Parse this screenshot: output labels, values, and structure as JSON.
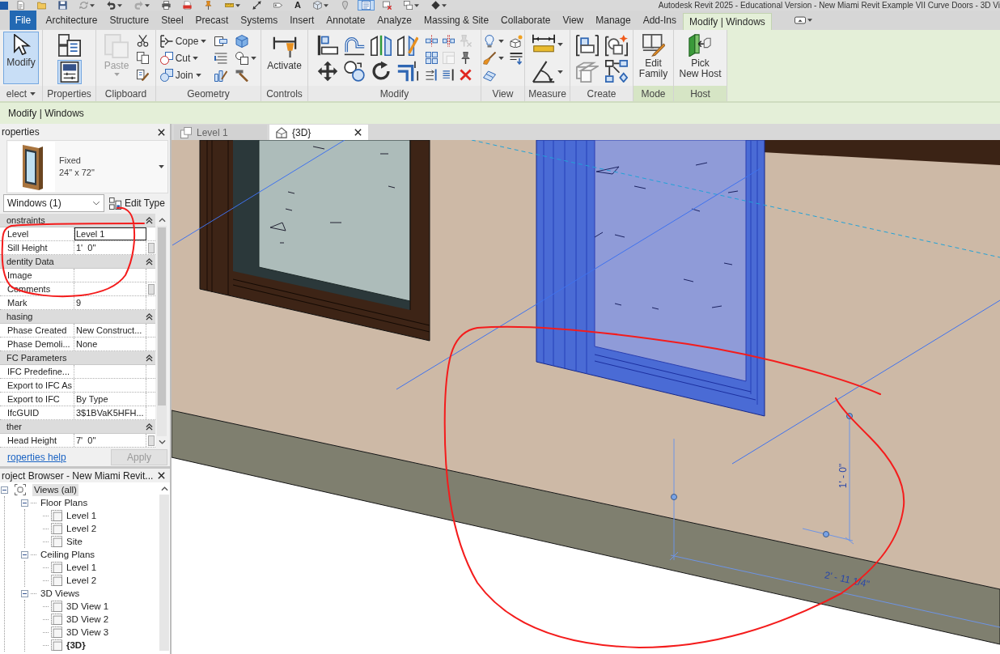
{
  "title_bar": {
    "title": "Autodesk Revit 2025 - Educational Version - New Miami Revit Example VII Curve Doors - 3D Vi"
  },
  "quick_access": [
    {
      "dropdown": false,
      "selected": false
    },
    {
      "dropdown": false,
      "selected": false
    },
    {
      "dropdown": false,
      "selected": false
    },
    {
      "dropdown": true,
      "selected": false
    },
    {
      "dropdown": true,
      "selected": false
    },
    {
      "dropdown": true,
      "selected": false
    },
    {
      "dropdown": false,
      "selected": false
    },
    {
      "dropdown": false,
      "selected": false
    },
    {
      "dropdown": false,
      "selected": false
    },
    {
      "dropdown": true,
      "selected": false
    },
    {
      "dropdown": false,
      "selected": false
    },
    {
      "dropdown": false,
      "selected": false
    },
    {
      "label": "A",
      "dropdown": false,
      "selected": false
    },
    {
      "dropdown": true,
      "selected": false
    },
    {
      "dropdown": false,
      "selected": false
    },
    {
      "dropdown": false,
      "selected": true
    },
    {
      "dropdown": false,
      "selected": false
    },
    {
      "dropdown": true,
      "selected": false
    },
    {
      "dropdown": true,
      "selected": false
    }
  ],
  "ribbon_tabs": [
    {
      "label": "File",
      "kind": "menu",
      "selected": false
    },
    {
      "label": "Architecture",
      "kind": "tab",
      "selected": false
    },
    {
      "label": "Structure",
      "kind": "tab",
      "selected": false
    },
    {
      "label": "Steel",
      "kind": "tab",
      "selected": false
    },
    {
      "label": "Precast",
      "kind": "tab",
      "selected": false
    },
    {
      "label": "Systems",
      "kind": "tab",
      "selected": false
    },
    {
      "label": "Insert",
      "kind": "tab",
      "selected": false
    },
    {
      "label": "Annotate",
      "kind": "tab",
      "selected": false
    },
    {
      "label": "Analyze",
      "kind": "tab",
      "selected": false
    },
    {
      "label": "Massing & Site",
      "kind": "tab",
      "selected": false
    },
    {
      "label": "Collaborate",
      "kind": "tab",
      "selected": false
    },
    {
      "label": "View",
      "kind": "tab",
      "selected": false
    },
    {
      "label": "Manage",
      "kind": "tab",
      "selected": false
    },
    {
      "label": "Add-Ins",
      "kind": "tab",
      "selected": false
    },
    {
      "label": "Modify | Windows",
      "kind": "tab",
      "selected": true
    }
  ],
  "ribbon_panels": [
    {
      "label": "elect",
      "dropdown": true,
      "contextual": false,
      "tools": [
        {
          "label": "Modify",
          "selected": true,
          "disabled": false,
          "dropdown": false
        }
      ]
    },
    {
      "label": "Properties",
      "dropdown": false,
      "contextual": false,
      "tools": [
        {
          "selected": false,
          "disabled": false,
          "dropdown": false
        },
        {
          "selected": true,
          "disabled": false,
          "dropdown": false
        }
      ]
    },
    {
      "label": "Clipboard",
      "dropdown": false,
      "contextual": false,
      "tools": [
        {
          "label": "Paste",
          "selected": false,
          "disabled": true,
          "dropdown": true
        },
        {
          "selected": false,
          "disabled": false,
          "dropdown": false
        },
        {
          "selected": false,
          "disabled": false,
          "dropdown": false
        },
        {
          "selected": false,
          "disabled": false,
          "dropdown": false
        }
      ]
    },
    {
      "label": "Geometry",
      "dropdown": false,
      "contextual": false,
      "tools": [
        {
          "label": "Cope",
          "selected": false,
          "disabled": false,
          "dropdown": true
        },
        {
          "label": "Cut",
          "selected": false,
          "disabled": false,
          "dropdown": true
        },
        {
          "label": "Join",
          "selected": false,
          "disabled": false,
          "dropdown": true
        },
        {
          "selected": false,
          "disabled": false,
          "dropdown": false
        },
        {
          "selected": false,
          "disabled": false,
          "dropdown": false
        },
        {
          "selected": false,
          "disabled": false,
          "dropdown": false
        },
        {
          "selected": false,
          "disabled": false,
          "dropdown": false
        },
        {
          "selected": false,
          "disabled": false,
          "dropdown": true
        },
        {
          "selected": false,
          "disabled": false,
          "dropdown": false
        }
      ]
    },
    {
      "label": "Controls",
      "dropdown": false,
      "contextual": false,
      "tools": [
        {
          "label": "Activate",
          "selected": false,
          "disabled": false,
          "dropdown": false
        }
      ]
    },
    {
      "label": "Modify",
      "dropdown": false,
      "contextual": false,
      "tools": [
        {
          "selected": false,
          "disabled": false,
          "dropdown": false
        },
        {
          "selected": false,
          "disabled": false,
          "dropdown": false
        },
        {
          "selected": false,
          "disabled": false,
          "dropdown": false
        },
        {
          "selected": false,
          "disabled": false,
          "dropdown": false
        },
        {
          "selected": false,
          "disabled": false,
          "dropdown": false
        },
        {
          "selected": false,
          "disabled": false,
          "dropdown": false
        },
        {
          "selected": false,
          "disabled": false,
          "dropdown": false
        },
        {
          "selected": false,
          "disabled": false,
          "dropdown": false
        },
        {
          "selected": false,
          "disabled": false,
          "dropdown": false
        },
        {
          "selected": false,
          "disabled": false,
          "dropdown": false
        },
        {
          "selected": false,
          "disabled": true,
          "dropdown": false
        },
        {
          "selected": false,
          "disabled": false,
          "dropdown": false
        },
        {
          "selected": false,
          "disabled": true,
          "dropdown": false
        },
        {
          "selected": false,
          "disabled": false,
          "dropdown": false
        },
        {
          "selected": false,
          "disabled": false,
          "dropdown": false
        },
        {
          "selected": false,
          "disabled": false,
          "dropdown": false
        },
        {
          "selected": false,
          "disabled": false,
          "dropdown": false
        }
      ]
    },
    {
      "label": "View",
      "dropdown": false,
      "contextual": false,
      "tools": [
        {
          "selected": false,
          "disabled": false,
          "dropdown": true
        },
        {
          "selected": false,
          "disabled": false,
          "dropdown": false
        },
        {
          "selected": false,
          "disabled": false,
          "dropdown": true
        },
        {
          "selected": false,
          "disabled": false,
          "dropdown": false
        },
        {
          "selected": false,
          "disabled": false,
          "dropdown": false
        }
      ]
    },
    {
      "label": "Measure",
      "dropdown": false,
      "contextual": false,
      "tools": [
        {
          "selected": false,
          "disabled": false,
          "dropdown": true
        },
        {
          "selected": false,
          "disabled": false,
          "dropdown": true
        }
      ]
    },
    {
      "label": "Create",
      "dropdown": false,
      "contextual": false,
      "tools": [
        {
          "selected": false,
          "disabled": false,
          "dropdown": false
        },
        {
          "selected": false,
          "disabled": false,
          "dropdown": false
        },
        {
          "selected": false,
          "disabled": false,
          "dropdown": false
        },
        {
          "selected": false,
          "disabled": false,
          "dropdown": false
        }
      ]
    },
    {
      "label": "Mode",
      "dropdown": false,
      "contextual": true,
      "tools": [
        {
          "label_lines": [
            "Edit",
            "Family"
          ],
          "selected": false,
          "disabled": false,
          "dropdown": false
        }
      ]
    },
    {
      "label": "Host",
      "dropdown": false,
      "contextual": true,
      "tools": [
        {
          "label_lines": [
            "Pick",
            "New Host"
          ],
          "selected": false,
          "disabled": false,
          "dropdown": false
        }
      ]
    }
  ],
  "options_bar": {
    "label": "Modify | Windows"
  },
  "properties": {
    "title": "roperties",
    "type_family": "Fixed",
    "type_name": "24\" x 72\"",
    "filter": "Windows (1)",
    "edit_type": "Edit Type",
    "groups": [
      {
        "label": "onstraints",
        "expanded": true,
        "rows": [
          {
            "name": "Level",
            "value": "Level 1",
            "focused": true,
            "button": false
          },
          {
            "name": "Sill Height",
            "value": "1'  0\"",
            "focused": false,
            "button": true
          }
        ]
      },
      {
        "label": "dentity Data",
        "expanded": true,
        "rows": [
          {
            "name": "Image",
            "focused": false,
            "button": false
          },
          {
            "name": "Comments",
            "focused": false,
            "button": true
          },
          {
            "name": "Mark",
            "value": "9",
            "focused": false,
            "button": false
          }
        ]
      },
      {
        "label": "hasing",
        "expanded": true,
        "rows": [
          {
            "name": "Phase Created",
            "value": "New Construct...",
            "focused": false,
            "button": false
          },
          {
            "name": "Phase Demoli...",
            "value": "None",
            "focused": false,
            "button": false
          }
        ]
      },
      {
        "label": "FC Parameters",
        "expanded": true,
        "rows": [
          {
            "name": "IFC Predefine...",
            "focused": false,
            "button": false
          },
          {
            "name": "Export to IFC As",
            "focused": false,
            "button": false
          },
          {
            "name": "Export to IFC",
            "value": "By Type",
            "focused": false,
            "button": false
          },
          {
            "name": "IfcGUID",
            "value": "3$1BVaK5HFH...",
            "focused": false,
            "button": false
          }
        ]
      },
      {
        "label": "ther",
        "expanded": true,
        "rows": [
          {
            "name": "Head Height",
            "value": "7'  0\"",
            "focused": false,
            "button": true
          }
        ]
      }
    ],
    "help_link": "roperties help",
    "apply": {
      "label": "Apply",
      "disabled": true
    }
  },
  "project_browser": {
    "title": "roject Browser - New Miami Revit...",
    "tree": [
      {
        "label": "Views (all)",
        "expanded": true,
        "selected": true,
        "children": [
          {
            "label": "Floor Plans",
            "expanded": true,
            "selected": false,
            "children": [
              {
                "label": "Level 1",
                "selected": false,
                "current": false
              },
              {
                "label": "Level 2",
                "selected": false,
                "current": false
              },
              {
                "label": "Site",
                "selected": false,
                "current": false
              }
            ]
          },
          {
            "label": "Ceiling Plans",
            "expanded": true,
            "selected": false,
            "children": [
              {
                "label": "Level 1",
                "selected": false,
                "current": false
              },
              {
                "label": "Level 2",
                "selected": false,
                "current": false
              }
            ]
          },
          {
            "label": "3D Views",
            "expanded": true,
            "selected": false,
            "children": [
              {
                "label": "3D View 1",
                "selected": false,
                "current": false
              },
              {
                "label": "3D View 2",
                "selected": false,
                "current": false
              },
              {
                "label": "3D View 3",
                "selected": false,
                "current": false
              },
              {
                "label": "{3D}",
                "selected": false,
                "current": true
              }
            ]
          }
        ]
      }
    ]
  },
  "view_tabs": [
    {
      "label": "Level 1",
      "kind": "plan",
      "selected": false
    },
    {
      "label": "{3D}",
      "kind": "model",
      "selected": true
    }
  ],
  "viewport": {
    "dimension_texts": [
      "1' - 0\"",
      "2' - 11 1/4\""
    ]
  }
}
